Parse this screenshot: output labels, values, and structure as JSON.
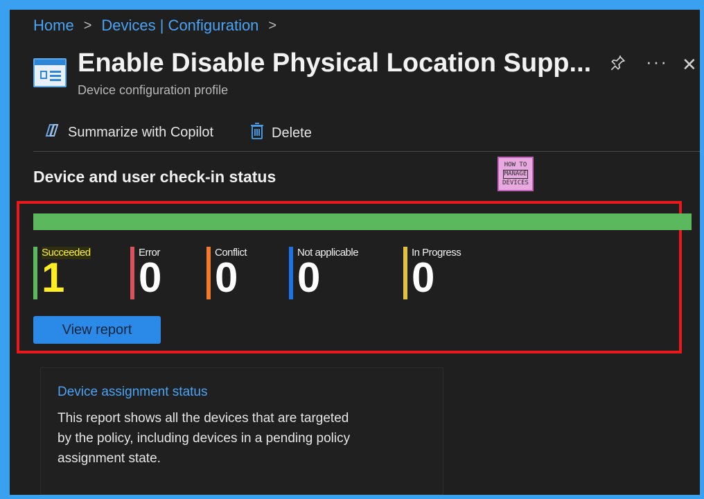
{
  "breadcrumb": {
    "home": "Home",
    "parent": "Devices | Configuration",
    "separator": ">"
  },
  "header": {
    "title": "Enable Disable Physical Location Supp...",
    "subtitle": "Device configuration profile",
    "pin": "✎",
    "more": "···",
    "close": "✕"
  },
  "toolbar": {
    "copilot_label": "Summarize with Copilot",
    "delete_label": "Delete"
  },
  "checkin": {
    "title": "Device and user check-in status",
    "progress_succeeded_fraction": 1.0,
    "stats": [
      {
        "label": "Succeeded",
        "count": "1",
        "color": "#5cb85c"
      },
      {
        "label": "Error",
        "count": "0",
        "color": "#d9535f"
      },
      {
        "label": "Conflict",
        "count": "0",
        "color": "#f07a2e"
      },
      {
        "label": "Not applicable",
        "count": "0",
        "color": "#1a73e8"
      },
      {
        "label": "In Progress",
        "count": "0",
        "color": "#e2c044"
      }
    ],
    "view_report_label": "View report"
  },
  "watermark": {
    "line1": "HOW TO",
    "line2": "MANAGE",
    "line3": "DEVICES"
  },
  "assignment_card": {
    "title": "Device assignment status",
    "description": "This report shows all the devices that are targeted by the policy, including devices in a pending policy assignment state."
  }
}
